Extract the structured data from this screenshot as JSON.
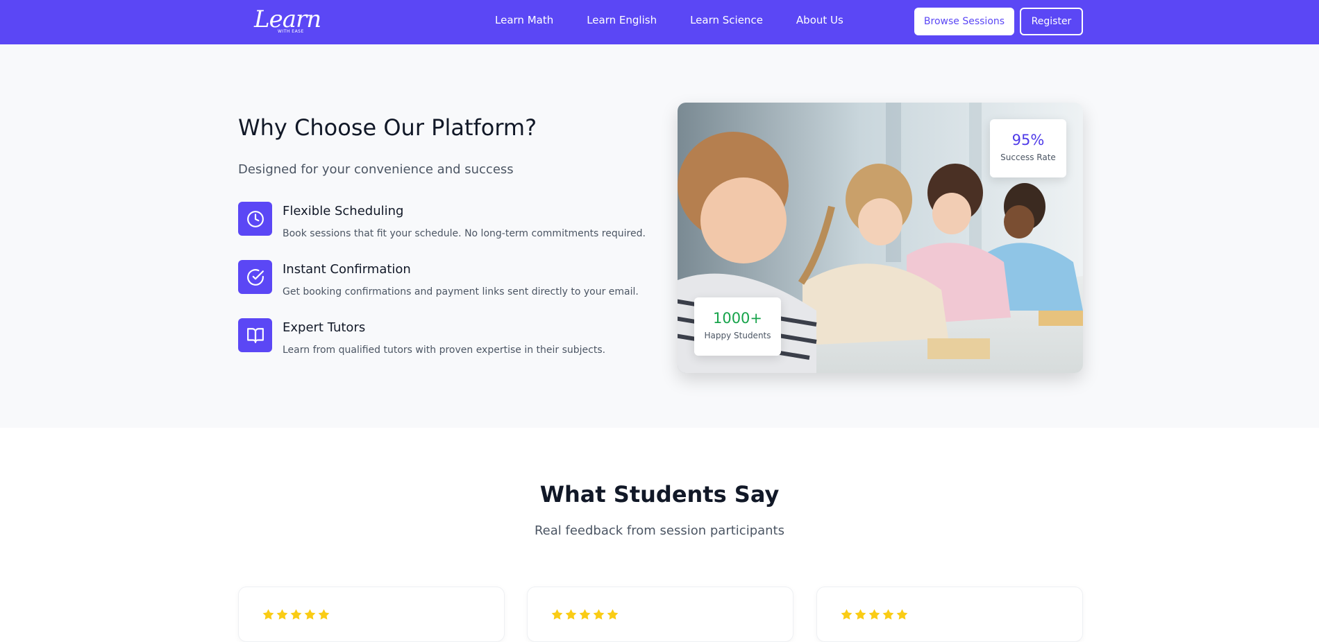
{
  "brand": {
    "logo_text": "Learn",
    "logo_subtext": "WITH EASE"
  },
  "nav": {
    "links": [
      "Learn Math",
      "Learn English",
      "Learn Science",
      "About Us"
    ],
    "browse_label": "Browse Sessions",
    "register_label": "Register"
  },
  "why": {
    "title": "Why Choose Our Platform?",
    "subtitle": "Designed for your convenience and success",
    "features": [
      {
        "icon": "clock-icon",
        "title": "Flexible Scheduling",
        "desc": "Book sessions that fit your schedule. No long-term commitments required."
      },
      {
        "icon": "check-circle-icon",
        "title": "Instant Confirmation",
        "desc": "Get booking confirmations and payment links sent directly to your email."
      },
      {
        "icon": "book-open-icon",
        "title": "Expert Tutors",
        "desc": "Learn from qualified tutors with proven expertise in their subjects."
      }
    ],
    "stats": {
      "success_value": "95%",
      "success_label": "Success Rate",
      "students_value": "1000+",
      "students_label": "Happy Students"
    }
  },
  "testimonials": {
    "title": "What Students Say",
    "subtitle": "Real feedback from session participants",
    "cards": [
      {
        "rating": 5
      },
      {
        "rating": 5
      },
      {
        "rating": 5
      }
    ]
  },
  "colors": {
    "primary": "#5b47f5",
    "star": "#facc15",
    "success": "#16a34a",
    "section_bg": "#f8f9fb"
  }
}
